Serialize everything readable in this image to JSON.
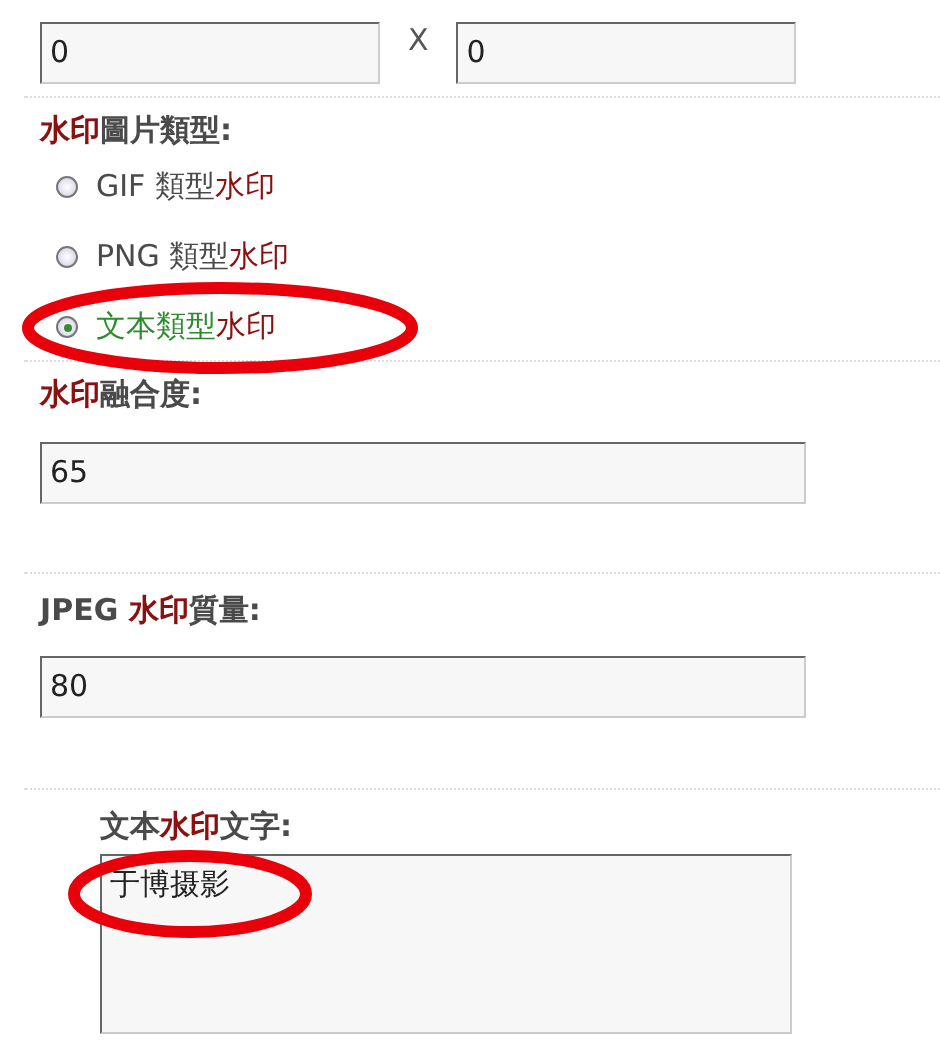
{
  "dimension_fields": [
    {
      "value": "0"
    },
    {
      "value": "0"
    }
  ],
  "dimension_separator": "X",
  "image_type": {
    "label": [
      {
        "text": "水印",
        "accent": true
      },
      {
        "text": "圖片類型:",
        "accent": false
      }
    ],
    "options": [
      {
        "label": [
          {
            "text": "GIF 類型",
            "accent": false
          },
          {
            "text": "水印",
            "accent": true
          }
        ],
        "selected": false,
        "circled": false
      },
      {
        "label": [
          {
            "text": "PNG 類型",
            "accent": false
          },
          {
            "text": "水印",
            "accent": true
          }
        ],
        "selected": false,
        "circled": false
      },
      {
        "label": [
          {
            "text": "文本類型",
            "accent": false
          },
          {
            "text": "水印",
            "accent": true
          }
        ],
        "selected": true,
        "circled": true
      }
    ]
  },
  "opacity": {
    "label": [
      {
        "text": "水印",
        "accent": true
      },
      {
        "text": "融合度:",
        "accent": false
      }
    ],
    "value": "65"
  },
  "jpeg_quality": {
    "label": [
      {
        "text": "JPEG ",
        "accent": false
      },
      {
        "text": "水印",
        "accent": true
      },
      {
        "text": "質量:",
        "accent": false
      }
    ],
    "value": "80"
  },
  "watermark_text": {
    "label": [
      {
        "text": "文本",
        "accent": false
      },
      {
        "text": "水印",
        "accent": true
      },
      {
        "text": "文字:",
        "accent": false
      }
    ],
    "value": "于博摄影",
    "circled": true
  }
}
